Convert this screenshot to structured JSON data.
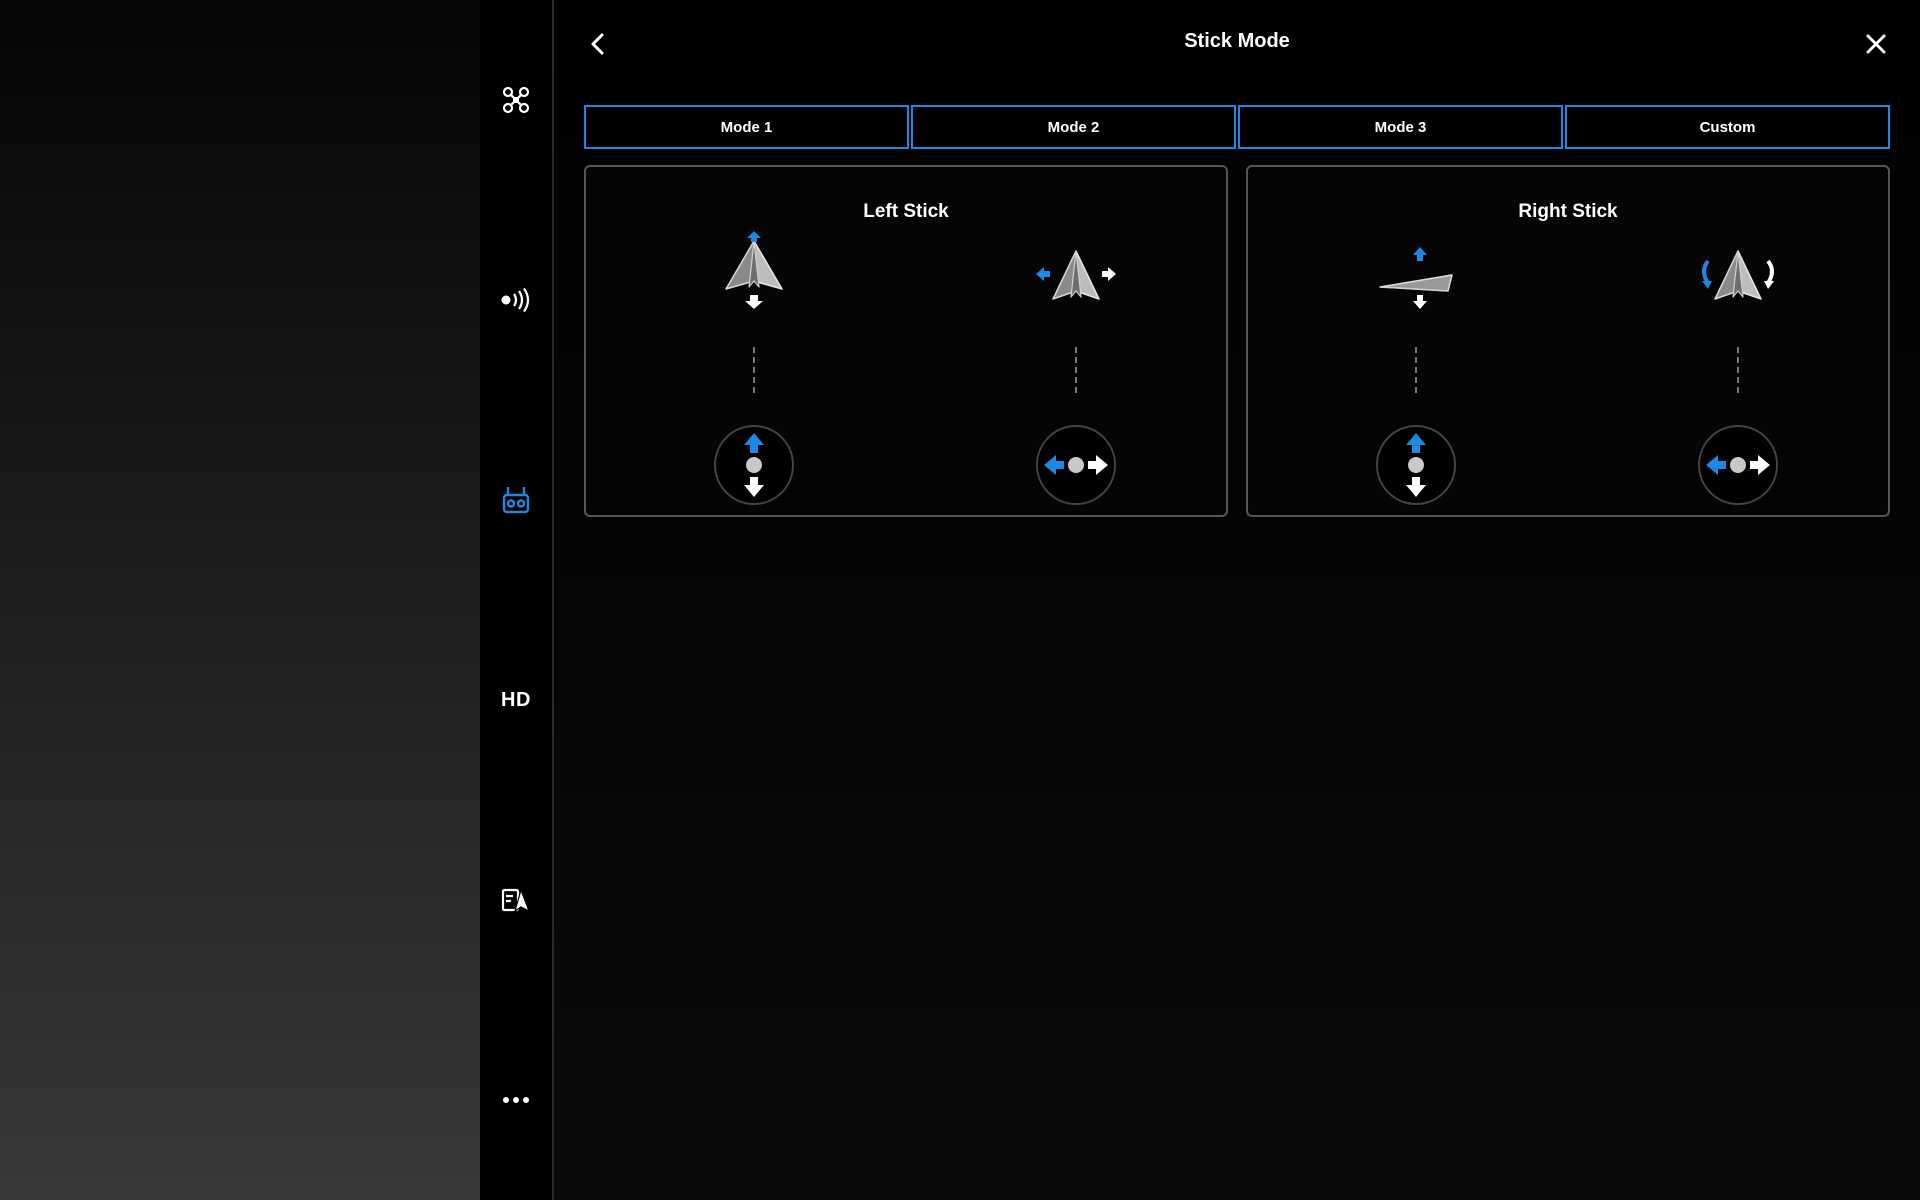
{
  "header": {
    "title": "Stick Mode",
    "back_icon": "chevron-left-icon",
    "close_icon": "close-icon"
  },
  "sidebar": {
    "items": [
      {
        "name": "aircraft",
        "icon": "drone-icon"
      },
      {
        "name": "signal",
        "icon": "signal-icon"
      },
      {
        "name": "remote-controller",
        "icon": "remote-controller-icon",
        "active": true
      },
      {
        "name": "hd",
        "label": "HD"
      },
      {
        "name": "safety",
        "icon": "flight-safety-icon"
      },
      {
        "name": "more",
        "icon": "more-icon"
      }
    ]
  },
  "tabs": [
    {
      "label": "Mode 1"
    },
    {
      "label": "Mode 2"
    },
    {
      "label": "Mode 3"
    },
    {
      "label": "Custom"
    }
  ],
  "sticks": {
    "left": {
      "title": "Left Stick",
      "vertical": {
        "aircraft_icon": "pitch-forward-back-icon",
        "stick_icon": "stick-up-down-icon"
      },
      "horizontal": {
        "aircraft_icon": "roll-left-right-icon",
        "stick_icon": "stick-left-right-icon"
      }
    },
    "right": {
      "title": "Right Stick",
      "vertical": {
        "aircraft_icon": "altitude-up-down-icon",
        "stick_icon": "stick-up-down-icon"
      },
      "horizontal": {
        "aircraft_icon": "yaw-rotate-icon",
        "stick_icon": "stick-left-right-icon"
      }
    }
  },
  "colors": {
    "accent": "#1e88e5",
    "background": "#000000",
    "border": "#555555",
    "text": "#ffffff"
  }
}
